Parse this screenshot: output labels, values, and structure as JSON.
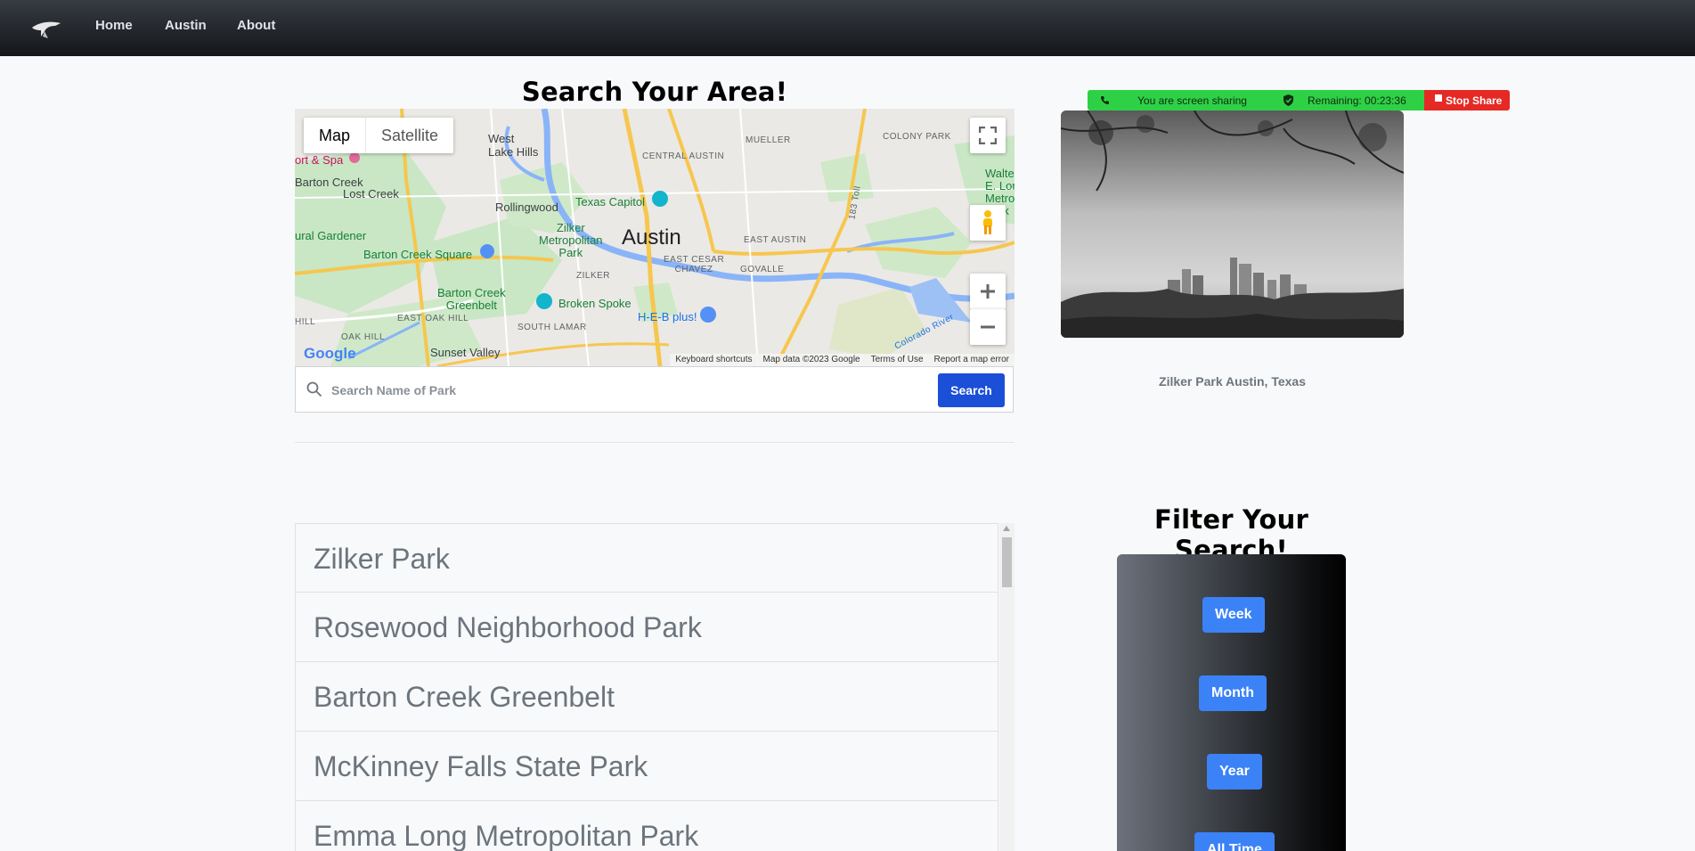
{
  "nav": {
    "logo_icon": "eagle-logo-icon",
    "items": [
      {
        "label": "Home"
      },
      {
        "label": "Austin"
      },
      {
        "label": "About"
      }
    ]
  },
  "search_section": {
    "title": "Search Your Area!",
    "map": {
      "type_buttons": [
        "Map",
        "Satellite"
      ],
      "active_type": "Map",
      "controls": [
        "fullscreen-icon",
        "pegman-icon",
        "zoom-in-icon",
        "zoom-out-icon"
      ],
      "labels": {
        "west_lake_hills": "West\nLake Hills",
        "mueller": "MUELLER",
        "colony_park": "COLONY PARK",
        "central_austin": "CENTRAL AUSTIN",
        "barton_creek": "Barton Creek",
        "lost_creek": "Lost Creek",
        "rollingwood": "Rollingwood",
        "texas_capitol": "Texas Capitol",
        "zilker_park": "Zilker\nMetropolitan\nPark",
        "austin": "Austin",
        "east_austin": "EAST AUSTIN",
        "walter_e_long": "Walte\nE. Lon\nMetropo\nPark",
        "rural_gardener": "ural Gardener",
        "barton_creek_square": "Barton Creek Square",
        "east_cesar_chavez": "EAST CESAR\nCHAVEZ",
        "govalle": "GOVALLE",
        "zilker": "ZILKER",
        "barton_creek_greenbelt": "Barton Creek\nGreenbelt",
        "broken_spoke": "Broken Spoke",
        "heb_plus": "H-E-B plus!",
        "east_oak_hill": "EAST OAK HILL",
        "south_lamar": "SOUTH LAMAR",
        "hill": "HILL",
        "oak_hill": "OAK HILL",
        "sunset_valley": "Sunset Valley",
        "resort_spa": "ort & Spa",
        "colorado_river": "Colorado River",
        "toll_183": "183 Toll"
      },
      "google_logo": "Google",
      "footer": [
        "Keyboard shortcuts",
        "Map data ©2023 Google",
        "Terms of Use",
        "Report a map error"
      ]
    },
    "search": {
      "placeholder": "Search Name of Park",
      "value": "",
      "button_label": "Search"
    }
  },
  "parks": [
    "Zilker Park",
    "Rosewood Neighborhood Park",
    "Barton Creek Greenbelt",
    "McKinney Falls State Park",
    "Emma Long Metropolitan Park"
  ],
  "screen_share": {
    "status": "You are screen sharing",
    "remaining": "Remaining: 00:23:36",
    "stop_label": "Stop Share"
  },
  "photo": {
    "caption": "Zilker Park Austin, Texas"
  },
  "filter": {
    "title": "Filter Your Search!",
    "buttons": [
      "Week",
      "Month",
      "Year",
      "All Time"
    ]
  },
  "colors": {
    "nav_bg": "#23272c",
    "search_button": "#1b4fd8",
    "filter_button": "#3b82f6",
    "share_green": "#2ed146",
    "share_red": "#e52925"
  }
}
